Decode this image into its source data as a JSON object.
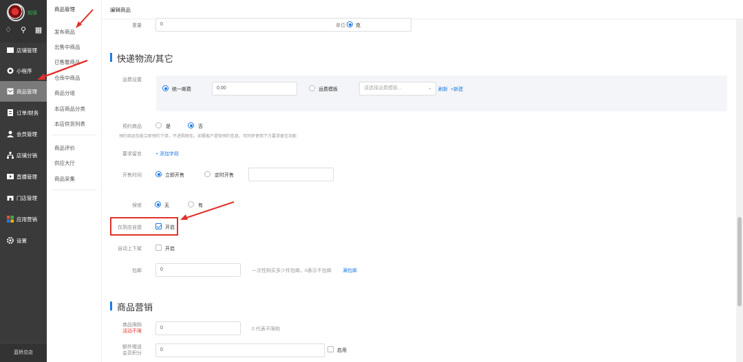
{
  "sidebar": {
    "brand": "知驿",
    "items": [
      {
        "label": "店铺管理"
      },
      {
        "label": "小程序"
      },
      {
        "label": "商品管理"
      },
      {
        "label": "订单/财务"
      },
      {
        "label": "会员管理"
      },
      {
        "label": "店铺分销"
      },
      {
        "label": "直播管理"
      },
      {
        "label": "门店管理"
      },
      {
        "label": "应用营销"
      },
      {
        "label": "设置"
      }
    ],
    "footer": "蓝桥总店"
  },
  "submenu": {
    "title": "商品管理",
    "items": [
      "发布商品",
      "出售中商品",
      "已售罄商品",
      "仓库中商品",
      "商品分组",
      "本店商品分类",
      "本店供货列表"
    ],
    "items2": [
      "商品评价",
      "供应大厅",
      "商品采集"
    ]
  },
  "topbar": {
    "crumb": "编辑商品"
  },
  "form": {
    "weight_label": "重量",
    "weight_value": "0",
    "unit_label": "单位:",
    "unit_value": "克",
    "section_logistics": "快递物流/其它",
    "freight_label": "运费设置",
    "freight_unified": "统一邮费",
    "freight_value": "0.00",
    "freight_template": "运费模板",
    "freight_template_placeholder": "请选择运费模板...",
    "refresh": "刷新",
    "add_new": "+新建",
    "presale_label": "预约商品",
    "presale_yes": "是",
    "presale_no": "否",
    "presale_hint": "预约商品仅能立即预约下单，不进购物车。如需客户提供预约信息，可同步使用下方要求留言功能",
    "message_label": "要求留言",
    "add_field": "+ 添加字段",
    "sale_time_label": "开售时间",
    "sale_now": "立即开售",
    "sale_timed": "定时开售",
    "warranty_label": "保修",
    "warranty_none": "无",
    "warranty_yes": "有",
    "self_pickup_label": "仅到店自提",
    "self_pickup_on": "开启",
    "auto_shelf_label": "自动上下架",
    "auto_shelf_on": "开启",
    "free_ship_label": "包邮",
    "free_ship_value": "0",
    "free_ship_hint": "一次性购买多少件包邮，0表示不包邮",
    "free_ship_link": "满包邮",
    "section_marketing": "商品营销",
    "limit_label": "商品限购",
    "limit_sub": "活动不限",
    "limit_value": "0",
    "limit_hint": "0 代表不限购",
    "extra_points_label": "额外赠送",
    "extra_points_sub": "会员积分",
    "extra_points_value": "0",
    "enable": "启用"
  },
  "colors": {
    "accent": "#1e7be6",
    "annotation": "#e0312a",
    "sidebar": "#3a3a3a"
  }
}
